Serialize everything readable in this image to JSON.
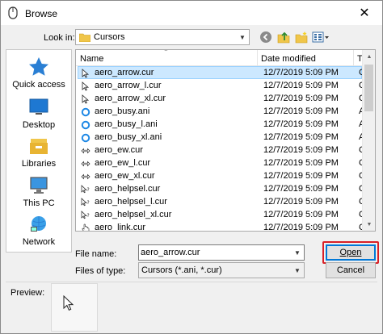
{
  "window": {
    "title": "Browse",
    "close_glyph": "✕"
  },
  "lookin": {
    "label": "Look in:",
    "value": "Cursors"
  },
  "toolbar": {
    "icons": [
      "back-icon",
      "up-folder-icon",
      "new-folder-icon",
      "view-menu-icon"
    ]
  },
  "places": [
    {
      "label": "Quick access",
      "icon": "star-icon"
    },
    {
      "label": "Desktop",
      "icon": "desktop-icon"
    },
    {
      "label": "Libraries",
      "icon": "libraries-icon"
    },
    {
      "label": "This PC",
      "icon": "computer-icon"
    },
    {
      "label": "Network",
      "icon": "network-icon"
    }
  ],
  "columns": {
    "name": "Name",
    "date": "Date modified",
    "type": "Ty"
  },
  "files": [
    {
      "name": "aero_arrow.cur",
      "date": "12/7/2019 5:09 PM",
      "type": "Cu",
      "icon": "arrow-cursor-icon",
      "selected": true
    },
    {
      "name": "aero_arrow_l.cur",
      "date": "12/7/2019 5:09 PM",
      "type": "Cu",
      "icon": "arrow-cursor-icon"
    },
    {
      "name": "aero_arrow_xl.cur",
      "date": "12/7/2019 5:09 PM",
      "type": "Cu",
      "icon": "arrow-cursor-icon"
    },
    {
      "name": "aero_busy.ani",
      "date": "12/7/2019 5:09 PM",
      "type": "An",
      "icon": "busy-cursor-icon"
    },
    {
      "name": "aero_busy_l.ani",
      "date": "12/7/2019 5:09 PM",
      "type": "An",
      "icon": "busy-cursor-icon"
    },
    {
      "name": "aero_busy_xl.ani",
      "date": "12/7/2019 5:09 PM",
      "type": "An",
      "icon": "busy-cursor-icon"
    },
    {
      "name": "aero_ew.cur",
      "date": "12/7/2019 5:09 PM",
      "type": "Cu",
      "icon": "resize-ew-cursor-icon"
    },
    {
      "name": "aero_ew_l.cur",
      "date": "12/7/2019 5:09 PM",
      "type": "Cu",
      "icon": "resize-ew-cursor-icon"
    },
    {
      "name": "aero_ew_xl.cur",
      "date": "12/7/2019 5:09 PM",
      "type": "Cu",
      "icon": "resize-ew-cursor-icon"
    },
    {
      "name": "aero_helpsel.cur",
      "date": "12/7/2019 5:09 PM",
      "type": "Cu",
      "icon": "help-cursor-icon"
    },
    {
      "name": "aero_helpsel_l.cur",
      "date": "12/7/2019 5:09 PM",
      "type": "Cu",
      "icon": "help-cursor-icon"
    },
    {
      "name": "aero_helpsel_xl.cur",
      "date": "12/7/2019 5:09 PM",
      "type": "Cu",
      "icon": "help-cursor-icon"
    },
    {
      "name": "aero_link.cur",
      "date": "12/7/2019 5:09 PM",
      "type": "Cu",
      "icon": "link-cursor-icon"
    }
  ],
  "filename": {
    "label": "File name:",
    "value": "aero_arrow.cur"
  },
  "filetype": {
    "label": "Files of type:",
    "value": "Cursors (*.ani, *.cur)"
  },
  "buttons": {
    "open": "Open",
    "cancel": "Cancel"
  },
  "preview": {
    "label": "Preview:"
  },
  "colors": {
    "selection": "#cce8ff",
    "accent": "#0078d7",
    "highlight": "#d81f26"
  }
}
